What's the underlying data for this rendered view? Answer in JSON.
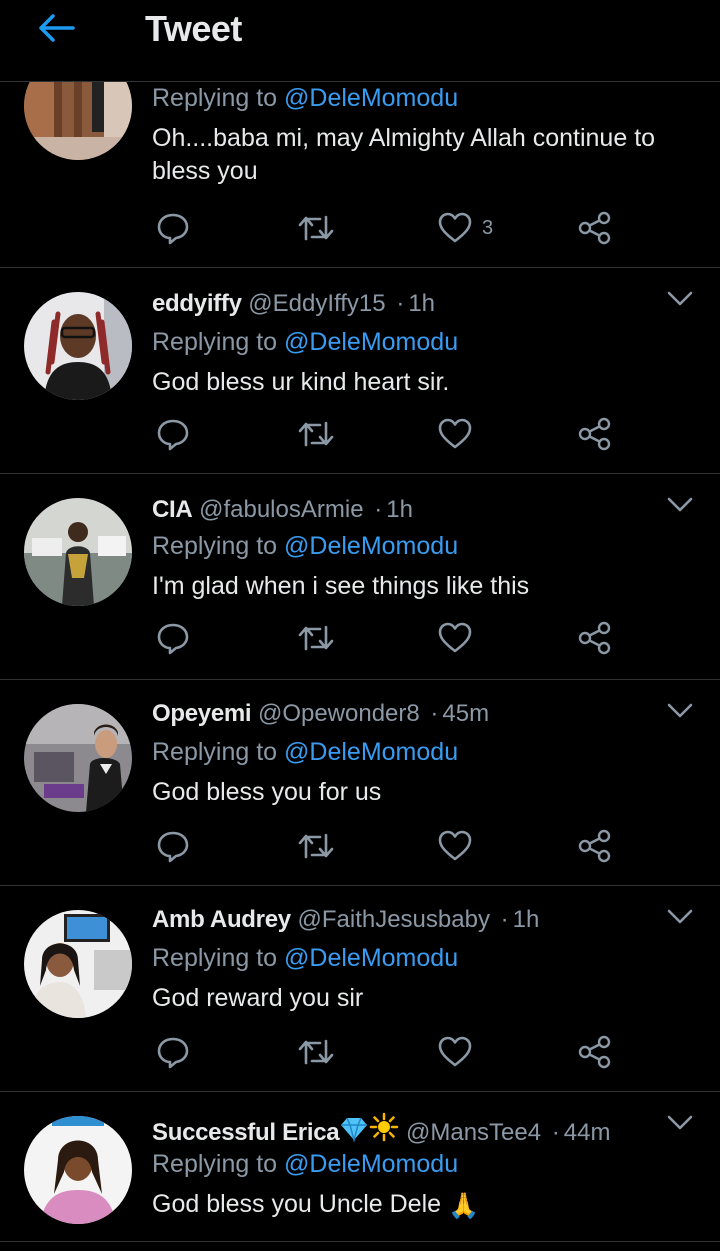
{
  "header": {
    "title": "Tweet",
    "back_icon": "arrow-left-icon",
    "accent": "#1d9bf0"
  },
  "colors": {
    "mention": "#3a9cf0",
    "secondary_text": "#8b98a5",
    "primary_text": "#e7e9ea",
    "divider": "#2f3336",
    "background": "#000000"
  },
  "tweets": [
    {
      "name": "",
      "handle": "",
      "time": "",
      "replying_prefix": "Replying to",
      "replying_to": "@DeleMomodu",
      "text": "Oh....baba mi, may Almighty Allah continue to bless you",
      "like_count": "3",
      "emoji": ""
    },
    {
      "name": "eddyiffy",
      "handle": "@EddyIffy15",
      "time": "1h",
      "replying_prefix": "Replying to",
      "replying_to": "@DeleMomodu",
      "text": "God bless ur kind heart sir.",
      "like_count": "",
      "emoji": ""
    },
    {
      "name": "CIA",
      "handle": "@fabulosArmie",
      "time": "1h",
      "replying_prefix": "Replying to",
      "replying_to": "@DeleMomodu",
      "text": "I'm glad when i see things like this",
      "like_count": "",
      "emoji": ""
    },
    {
      "name": "Opeyemi",
      "handle": "@Opewonder8",
      "time": "45m",
      "replying_prefix": "Replying to",
      "replying_to": "@DeleMomodu",
      "text": "God bless you for us",
      "like_count": "",
      "emoji": ""
    },
    {
      "name": "Amb Audrey",
      "handle": "@FaithJesusbaby",
      "time": "1h",
      "replying_prefix": "Replying to",
      "replying_to": "@DeleMomodu",
      "text": "God reward you sir",
      "like_count": "",
      "emoji": ""
    },
    {
      "name": "Successful Erica",
      "handle": "@MansTee4",
      "time": "44m",
      "replying_prefix": "Replying to",
      "replying_to": "@DeleMomodu",
      "text": "God bless you Uncle Dele",
      "like_count": "",
      "emoji": "🙏"
    }
  ],
  "icons": [
    "reply-icon",
    "retweet-icon",
    "like-icon",
    "share-icon",
    "chevron-down-icon"
  ],
  "time_separator": "·"
}
